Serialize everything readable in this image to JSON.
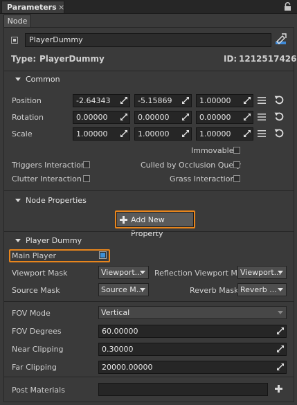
{
  "tab": {
    "title": "Parameters",
    "close": "×"
  },
  "subtab": {
    "label": "Node"
  },
  "node": {
    "name": "PlayerDummy",
    "type_label": "Type:",
    "type_value": "PlayerDummy",
    "id_label": "ID:",
    "id_value": "1212517426"
  },
  "common": {
    "title": "Common",
    "position": {
      "label": "Position",
      "x": "-2.64343",
      "y": "-5.15869",
      "z": "1.00000"
    },
    "rotation": {
      "label": "Rotation",
      "x": "0.00000",
      "y": "0.00000",
      "z": "0.00000"
    },
    "scale": {
      "label": "Scale",
      "x": "1.00000",
      "y": "1.00000",
      "z": "1.00000"
    },
    "immovable": "Immovable",
    "triggers_interaction": "Triggers Interaction",
    "culled_by_occlusion": "Culled by Occlusion Query",
    "clutter_interaction": "Clutter Interaction",
    "grass_interaction": "Grass Interaction"
  },
  "node_properties": {
    "title": "Node Properties",
    "add_button": "Add New Property"
  },
  "player_dummy": {
    "title": "Player Dummy",
    "main_player": {
      "label": "Main Player",
      "checked": true
    },
    "viewport_mask": {
      "label": "Viewport Mask",
      "value": "Viewport..."
    },
    "reflection_viewport_mask": {
      "label": "Reflection Viewport M...",
      "value": "Viewport..."
    },
    "source_mask": {
      "label": "Source Mask",
      "value": "Source M..."
    },
    "reverb_mask": {
      "label": "Reverb Mask",
      "value": "Reverb ..."
    },
    "fov_mode": {
      "label": "FOV Mode",
      "value": "Vertical"
    },
    "fov_degrees": {
      "label": "FOV Degrees",
      "value": "60.00000"
    },
    "near_clipping": {
      "label": "Near Clipping",
      "value": "0.30000"
    },
    "far_clipping": {
      "label": "Far Clipping",
      "value": "20000.00000"
    },
    "post_materials": {
      "label": "Post Materials",
      "value": ""
    }
  },
  "colors": {
    "accent_orange": "#e8851c",
    "checked_blue": "#3d8fd6",
    "background": "#3a3a3a"
  }
}
